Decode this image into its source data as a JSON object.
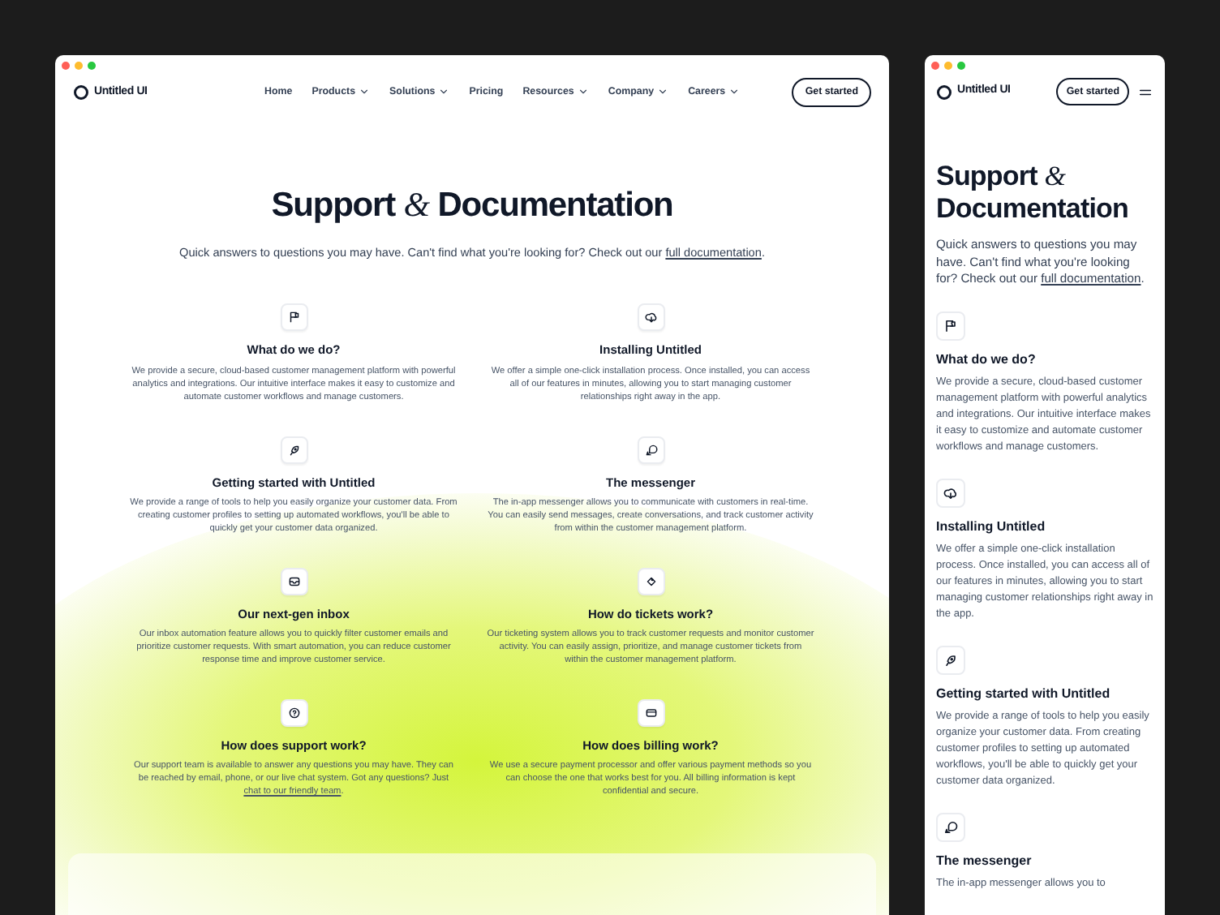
{
  "desktop": {
    "brand": "Untitled UI",
    "nav": [
      {
        "label": "Home",
        "has_menu": false
      },
      {
        "label": "Products",
        "has_menu": true
      },
      {
        "label": "Solutions",
        "has_menu": true
      },
      {
        "label": "Pricing",
        "has_menu": false
      },
      {
        "label": "Resources",
        "has_menu": true
      },
      {
        "label": "Company",
        "has_menu": true
      },
      {
        "label": "Careers",
        "has_menu": true
      }
    ],
    "cta": "Get started",
    "heading": "Support *&* Documentation",
    "intro": {
      "text": "Quick answers to questions you may have. Can't find what you're looking for? Check out our ",
      "link": "full documentation",
      "after": "."
    },
    "faqs": [
      {
        "title": "What do we do?",
        "text": "We provide a secure, cloud-based customer management platform with powerful analytics and integrations. Our intuitive interface makes it easy to customize and automate customer workflows and manage customers."
      },
      {
        "title": "Installing Untitled",
        "text": "We offer a simple one-click installation process. Once installed, you can access all of our features in minutes, allowing you to start managing customer relationships right away in the app."
      },
      {
        "title": "Getting started with Untitled",
        "text": "We provide a range of tools to help you easily organize your customer data. From creating customer profiles to setting up automated workflows, you'll be able to quickly get your customer data organized."
      },
      {
        "title": "The messenger",
        "text": "The in-app messenger allows you to communicate with customers in real-time. You can easily send messages, create conversations, and track customer activity from within the customer management platform."
      },
      {
        "title": "Our next-gen inbox",
        "text": "Our inbox automation feature allows you to quickly filter customer emails and prioritize customer requests. With smart automation, you can reduce customer response time and improve customer service."
      },
      {
        "title": "How do tickets work?",
        "text": "Our ticketing system allows you to track customer requests and monitor customer activity. You can easily assign, prioritize, and manage customer tickets from within the customer management platform."
      },
      {
        "title": "How does support work?",
        "text": "Our support team is available to answer any questions you may have. They can be reached by email, phone, or our live chat system. Got any questions? Just ",
        "link": "chat to our friendly team",
        "after": "."
      },
      {
        "title": "How does billing work?",
        "text": "We use a secure payment processor and offer various payment methods so you can choose the one that works best for you. All billing information is kept confidential and secure."
      }
    ]
  },
  "mobile": {
    "brand": "Untitled UI",
    "cta": "Get started",
    "heading": "Support *&* Documentation",
    "intro": {
      "text": "Quick answers to questions you may have. Can't find what you're looking for? Check out our ",
      "link": "full documentation",
      "after": "."
    },
    "faqs": [
      {
        "title": "What do we do?",
        "text": "We provide a secure, cloud-based customer management platform with powerful analytics and integrations. Our intuitive interface makes it easy to customize and automate customer workflows and manage customers."
      },
      {
        "title": "Installing Untitled",
        "text": "We offer a simple one-click installation process. Once installed, you can access all of our features in minutes, allowing you to start managing customer relationships right away in the app."
      },
      {
        "title": "Getting started with Untitled",
        "text": "We provide a range of tools to help you easily organize your customer data. From creating customer profiles to setting up automated workflows, you'll be able to quickly get your customer data organized."
      },
      {
        "title": "The messenger",
        "text": "The in-app messenger allows you to"
      }
    ]
  }
}
